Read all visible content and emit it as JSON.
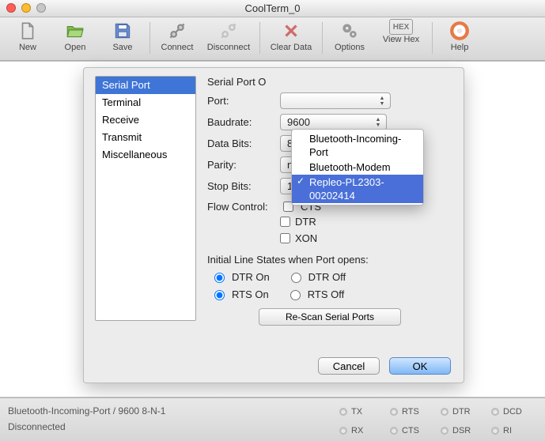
{
  "window": {
    "title": "CoolTerm_0"
  },
  "toolbar": {
    "new": "New",
    "open": "Open",
    "save": "Save",
    "connect": "Connect",
    "disconnect": "Disconnect",
    "clear": "Clear Data",
    "options": "Options",
    "viewhex": "View Hex",
    "help": "Help"
  },
  "sidebar": {
    "items": [
      "Serial Port",
      "Terminal",
      "Receive",
      "Transmit",
      "Miscellaneous"
    ],
    "selected": 0
  },
  "form": {
    "heading_prefix": "Serial Port O",
    "port_label": "Port:",
    "baud_label": "Baudrate:",
    "baud_value": "9600",
    "databits_label": "Data Bits:",
    "databits_value": "8",
    "parity_label": "Parity:",
    "parity_value": "none",
    "stopbits_label": "Stop Bits:",
    "stopbits_value": "1",
    "flow_label": "Flow Control:",
    "flow_cts": "CTS",
    "flow_dtr": "DTR",
    "flow_xon": "XON",
    "initial_heading": "Initial Line States when Port opens:",
    "dtr_on": "DTR On",
    "dtr_off": "DTR Off",
    "rts_on": "RTS On",
    "rts_off": "RTS Off",
    "rescan": "Re-Scan Serial Ports",
    "cancel": "Cancel",
    "ok": "OK"
  },
  "port_menu": {
    "items": [
      "Bluetooth-Incoming-Port",
      "Bluetooth-Modem",
      "Repleo-PL2303-00202414"
    ],
    "highlighted": 2
  },
  "statusbar": {
    "line1": "Bluetooth-Incoming-Port / 9600 8-N-1",
    "line2": "Disconnected",
    "leds": [
      "TX",
      "RX",
      "RTS",
      "CTS",
      "DTR",
      "DSR",
      "DCD",
      "RI"
    ]
  }
}
